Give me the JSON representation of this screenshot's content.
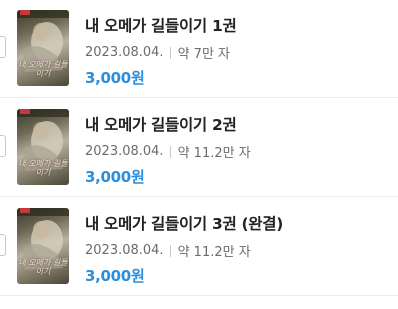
{
  "items": [
    {
      "title": "내 오메가 길들이기 1권",
      "date": "2023.08.04.",
      "length": "약 7만 자",
      "price": "3,000원",
      "cover_text": "내 오메가 길들이기"
    },
    {
      "title": "내 오메가 길들이기 2권",
      "date": "2023.08.04.",
      "length": "약 11.2만 자",
      "price": "3,000원",
      "cover_text": "내 오메가 길들이기"
    },
    {
      "title": "내 오메가 길들이기 3권 (완결)",
      "date": "2023.08.04.",
      "length": "약 11.2만 자",
      "price": "3,000원",
      "cover_text": "내 오메가 길들이기"
    }
  ],
  "colors": {
    "price": "#2b8fde",
    "title": "#222222",
    "meta": "#6b6b6b",
    "divider": "#ececec"
  }
}
